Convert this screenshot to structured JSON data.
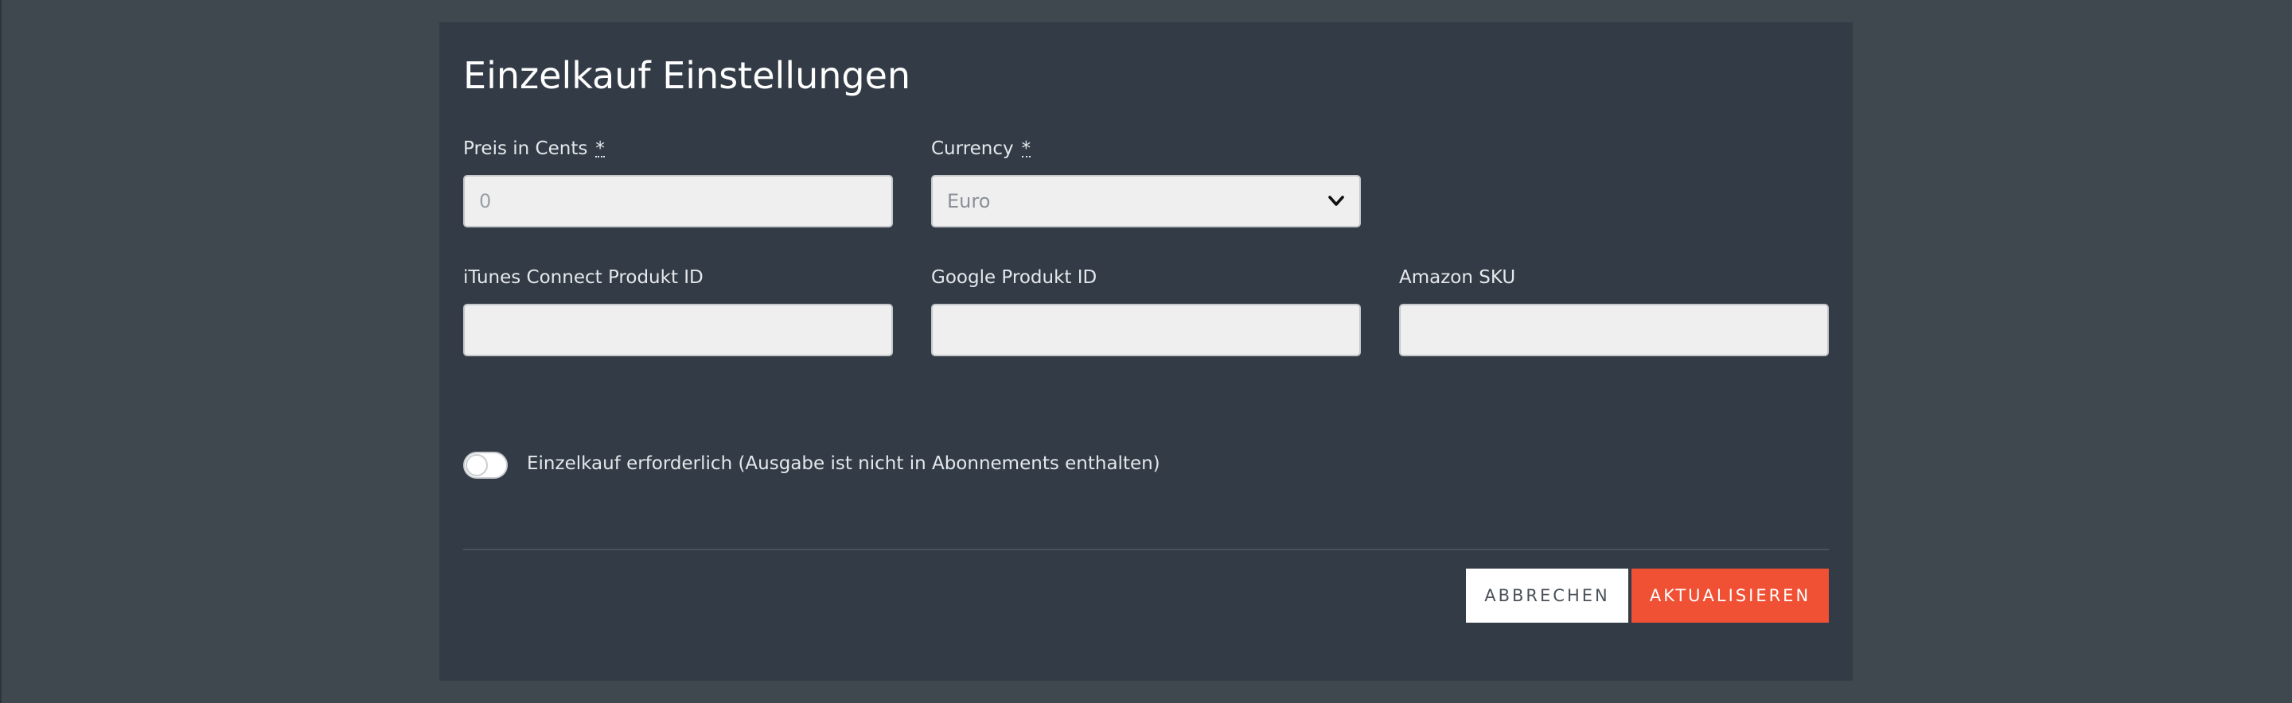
{
  "modal": {
    "title": "Einzelkauf Einstellungen"
  },
  "fields": {
    "price": {
      "label": "Preis in Cents",
      "required_marker": "*",
      "placeholder": "0",
      "value": ""
    },
    "currency": {
      "label": "Currency",
      "required_marker": "*",
      "selected": "Euro"
    },
    "itunes_id": {
      "label": "iTunes Connect Produkt ID",
      "value": ""
    },
    "google_id": {
      "label": "Google Produkt ID",
      "value": ""
    },
    "amazon_sku": {
      "label": "Amazon SKU",
      "value": ""
    }
  },
  "toggle": {
    "label": "Einzelkauf erforderlich (Ausgabe ist nicht in Abonnements enthalten)",
    "checked": false
  },
  "actions": {
    "cancel_label": "ABBRECHEN",
    "update_label": "AKTUALISIEREN"
  },
  "colors": {
    "backdrop": "#3f474f",
    "modal_bg": "#333c46",
    "accent": "#f05033"
  },
  "icons": {
    "currency_dropdown": "chevron-down-icon"
  }
}
